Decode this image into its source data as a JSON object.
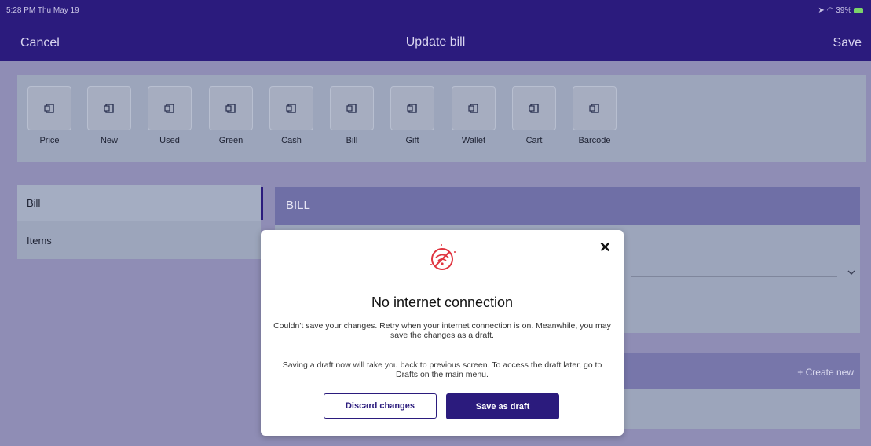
{
  "status_bar": {
    "time": "5:28 PM  Thu May 19",
    "battery": "39%"
  },
  "nav": {
    "cancel": "Cancel",
    "title": "Update bill",
    "save": "Save"
  },
  "toolbar": {
    "items": [
      {
        "label": "Price",
        "icon": "doc-icon"
      },
      {
        "label": "New",
        "icon": "doc-icon"
      },
      {
        "label": "Used",
        "icon": "doc-icon"
      },
      {
        "label": "Green",
        "icon": "doc-icon"
      },
      {
        "label": "Cash",
        "icon": "doc-icon"
      },
      {
        "label": "Bill",
        "icon": "doc-icon"
      },
      {
        "label": "Gift",
        "icon": "doc-icon"
      },
      {
        "label": "Wallet",
        "icon": "doc-icon"
      },
      {
        "label": "Cart",
        "icon": "doc-icon"
      },
      {
        "label": "Barcode",
        "icon": "doc-icon"
      }
    ]
  },
  "sidebar": {
    "items": [
      {
        "label": "Bill"
      },
      {
        "label": "Items"
      }
    ]
  },
  "main": {
    "section_title": "BILL",
    "create_new": "+ Create new"
  },
  "modal": {
    "title": "No internet connection",
    "message1": "Couldn't save your changes. Retry when your internet connection is on. Meanwhile, you may save the changes as a draft.",
    "message2": "Saving a draft now will take you back to previous screen. To access the draft later, go to Drafts on the main menu.",
    "discard": "Discard changes",
    "save_draft": "Save as draft"
  },
  "colors": {
    "brand": "#2b1b7d",
    "alert": "#e0343f"
  }
}
